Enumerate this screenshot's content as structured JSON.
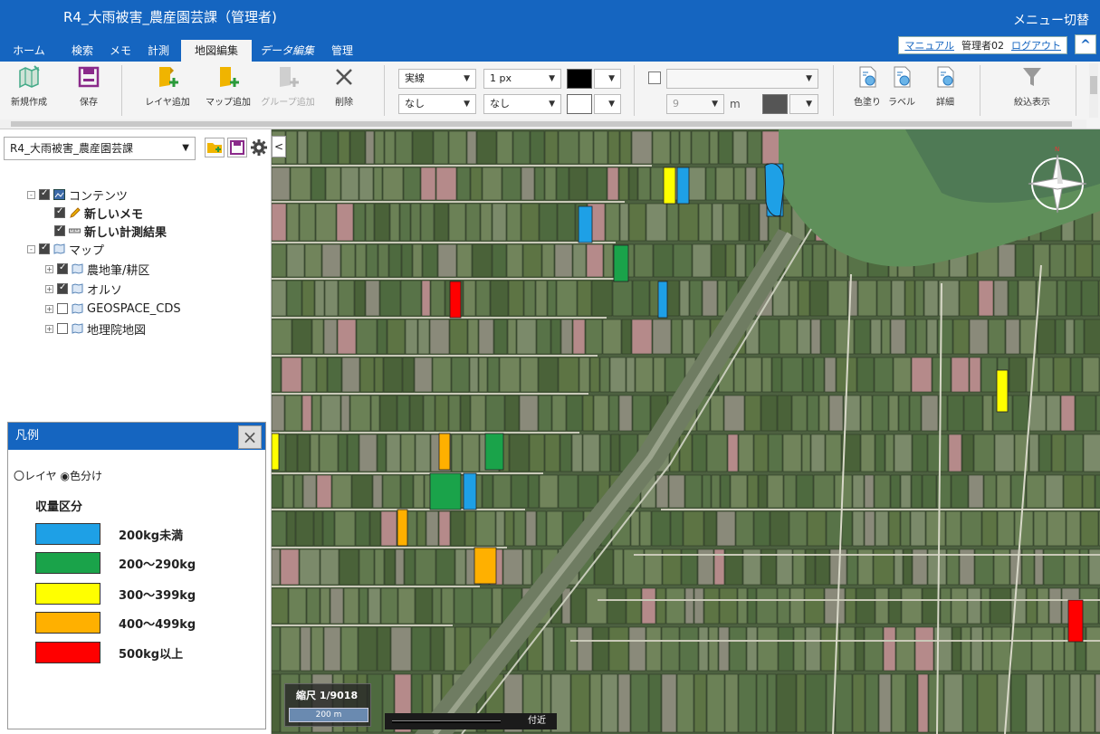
{
  "app": {
    "title": "R4_大雨被害_農産園芸課（管理者)",
    "menu_switch": "メニュー切替"
  },
  "tabs": [
    {
      "label": "ホーム"
    },
    {
      "label": "検索"
    },
    {
      "label": "メモ"
    },
    {
      "label": "計測"
    },
    {
      "label": "地図編集",
      "active": true
    },
    {
      "label": "データ編集"
    },
    {
      "label": "管理"
    }
  ],
  "user": {
    "manual_link": "マニュアル",
    "username": "管理者02",
    "logout_link": "ログアウト"
  },
  "ribbon": {
    "new_label": "新規作成",
    "save_label": "保存",
    "add_layer_label": "レイヤ追加",
    "add_map_label": "マップ追加",
    "add_group_label": "グループ追加",
    "delete_label": "削除",
    "line_style": "実線",
    "line_width": "1 px",
    "line_color": "#000000",
    "fill_style": "なし",
    "fill_style2": "なし",
    "fill_color": "#ffffff",
    "label_field": "",
    "font_size": "9",
    "unit": "m",
    "color_paint_label": "色塗り",
    "label_label": "ラベル",
    "detail_label": "詳細",
    "filter_label": "絞込表示"
  },
  "panel": {
    "project_name": "R4_大雨被害_農産園芸課",
    "tree": [
      {
        "label": "コンテンツ",
        "level": 0,
        "checked": true,
        "expander": "⊟",
        "bold": false
      },
      {
        "label": "新しいメモ",
        "level": 1,
        "checked": true,
        "bold": true
      },
      {
        "label": "新しい計測結果",
        "level": 1,
        "checked": true,
        "bold": true
      },
      {
        "label": "マップ",
        "level": 0,
        "checked": true,
        "expander": "⊟",
        "bold": false
      },
      {
        "label": "農地筆/耕区",
        "level": 1,
        "checked": true,
        "expander": "⊞",
        "bold": false
      },
      {
        "label": "オルソ",
        "level": 1,
        "checked": true,
        "expander": "⊞",
        "bold": false
      },
      {
        "label": "GEOSPACE_CDS",
        "level": 1,
        "checked": false,
        "expander": "⊞",
        "bold": false
      },
      {
        "label": "地理院地図",
        "level": 1,
        "checked": false,
        "expander": "⊞",
        "bold": false
      }
    ]
  },
  "legend": {
    "title": "凡例",
    "radio_layer": "〇レイヤ",
    "radio_color": "◉色分け",
    "section_title": "収量区分",
    "items": [
      {
        "label": "200kg未満",
        "color": "#1ea0e6"
      },
      {
        "label": "200～290kg",
        "color": "#1aa34a"
      },
      {
        "label": "300～399kg",
        "color": "#ffff00"
      },
      {
        "label": "400～499kg",
        "color": "#ffb000"
      },
      {
        "label": "500kg以上",
        "color": "#ff0000"
      }
    ]
  },
  "map": {
    "scale_text": "縮尺 1/9018",
    "scale_bar_label": "200 m",
    "near_label": "付近",
    "compass_label": "N"
  }
}
